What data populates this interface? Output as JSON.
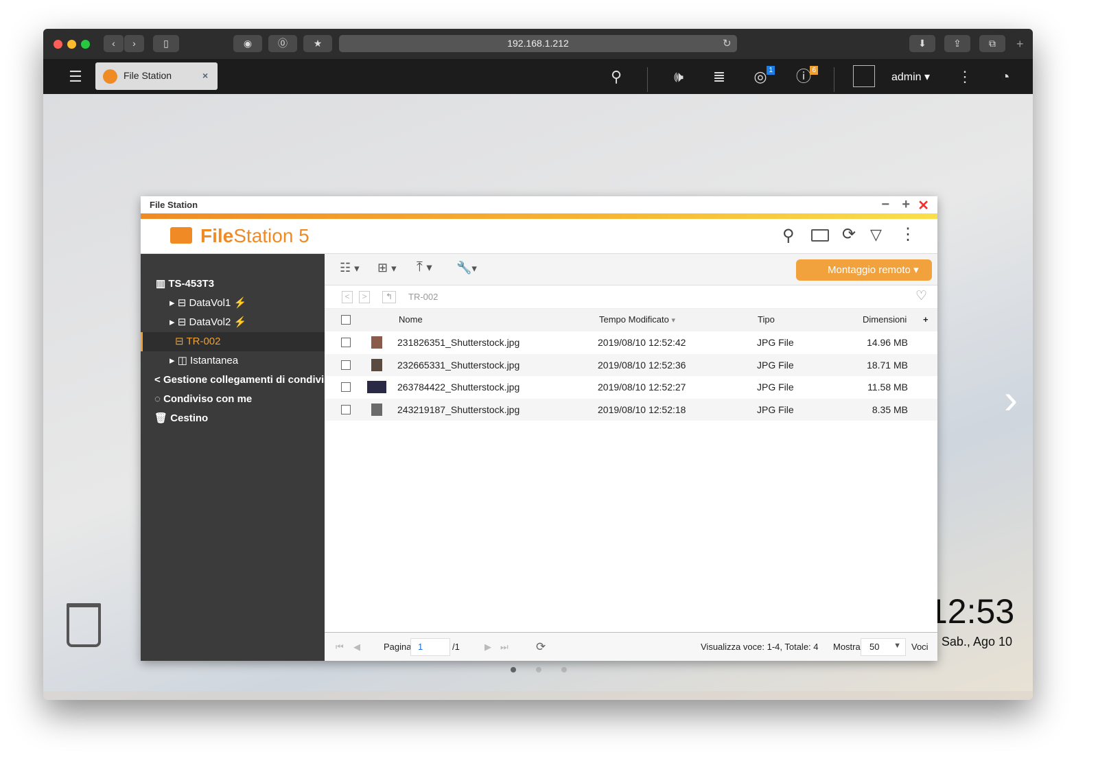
{
  "browser": {
    "url": "192.168.1.212"
  },
  "qts": {
    "tab_label": "File Station",
    "user": "admin",
    "notif_badge": "1",
    "info_badge": "6"
  },
  "desktop": {
    "clock": "12:53",
    "date": "Sab., Ago 10"
  },
  "filestation": {
    "window_title": "File Station",
    "logo_bold": "File",
    "logo_rest": "Station 5",
    "remote_mount": "Montaggio remoto",
    "path": "TR-002",
    "sidebar": {
      "root": "TS-453T3",
      "items": [
        {
          "label": "DataVol1"
        },
        {
          "label": "DataVol2"
        },
        {
          "label": "TR-002"
        },
        {
          "label": "Istantanea"
        }
      ],
      "share_links": "Gestione collegamenti di condivisione",
      "shared_with_me": "Condiviso con me",
      "trash": "Cestino"
    },
    "columns": {
      "name": "Nome",
      "modified": "Tempo Modificato",
      "type": "Tipo",
      "size": "Dimensioni",
      "add": "+"
    },
    "files": [
      {
        "name": "231826351_Shutterstock.jpg",
        "modified": "2019/08/10 12:52:42",
        "type": "JPG File",
        "size": "14.96 MB",
        "thumb": "#8a5a4a"
      },
      {
        "name": "232665331_Shutterstock.jpg",
        "modified": "2019/08/10 12:52:36",
        "type": "JPG File",
        "size": "18.71 MB",
        "thumb": "#5a4a40"
      },
      {
        "name": "263784422_Shutterstock.jpg",
        "modified": "2019/08/10 12:52:27",
        "type": "JPG File",
        "size": "11.58 MB",
        "thumb": "#2a2a45"
      },
      {
        "name": "243219187_Shutterstock.jpg",
        "modified": "2019/08/10 12:52:18",
        "type": "JPG File",
        "size": "8.35 MB",
        "thumb": "#6a6a6a"
      }
    ],
    "footer": {
      "page_label": "Pagina",
      "page": "1",
      "page_total": "/1",
      "summary": "Visualizza voce: 1-4, Totale: 4",
      "show_label": "Mostra",
      "per_page": "50",
      "items_label": "Voci"
    }
  }
}
